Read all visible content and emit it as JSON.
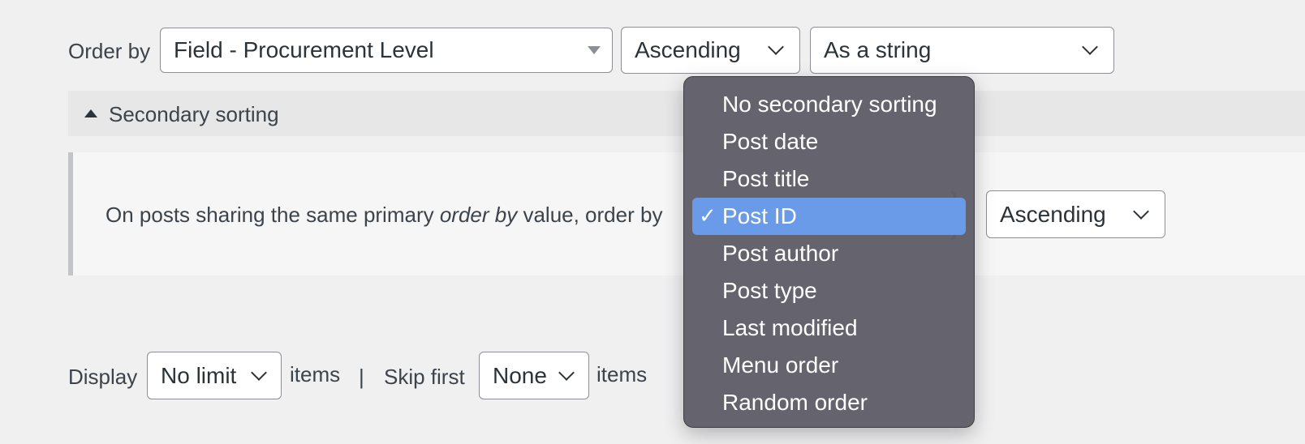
{
  "order_by": {
    "label": "Order by",
    "field_select": "Field - Procurement Level",
    "direction_select": "Ascending",
    "type_select": "As a string"
  },
  "secondary": {
    "toggle_label": "Secondary sorting",
    "text_before": "On posts sharing the same primary ",
    "text_italic": "order by",
    "text_after": " value, order by",
    "direction_select": "Ascending"
  },
  "dropdown_menu": {
    "selected_index": 3,
    "check_glyph": "✓",
    "items": [
      "No secondary sorting",
      "Post date",
      "Post title",
      "Post ID",
      "Post author",
      "Post type",
      "Last modified",
      "Menu order",
      "Random order"
    ]
  },
  "display": {
    "label": "Display",
    "limit_select": "No limit",
    "items_label": "items",
    "separator": "|",
    "skip_label": "Skip first",
    "skip_select": "None",
    "items_label_2": "items"
  },
  "colors": {
    "menu_bg": "#605e68",
    "menu_selected": "#6a9be8",
    "focus": "#2271b1",
    "page_bg": "#f0f0f1"
  }
}
